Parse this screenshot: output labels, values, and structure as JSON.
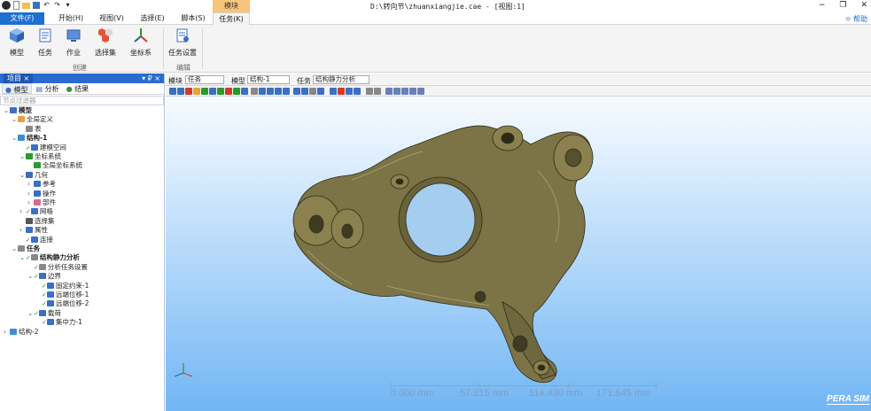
{
  "titlebar": {
    "title_path": "D:\\转向节\\zhuanxiangjie.cae - [视图:1]",
    "context_tab": "模块",
    "min_glyph": "−",
    "max_glyph": "❐",
    "close_glyph": "✕"
  },
  "tabs": [
    {
      "label": "文件(F)"
    },
    {
      "label": "开始(H)"
    },
    {
      "label": "视图(V)"
    },
    {
      "label": "选择(E)"
    },
    {
      "label": "脚本(S)"
    },
    {
      "label": "任务(K)"
    }
  ],
  "help_label": "≏ 帮助",
  "ribbon": {
    "buttons": [
      {
        "label": "模型",
        "icon": "model-cube-icon"
      },
      {
        "label": "任务",
        "icon": "task-icon"
      },
      {
        "label": "作业",
        "icon": "job-icon"
      },
      {
        "label": "选择集",
        "icon": "selection-set-icon"
      },
      {
        "label": "坐标系",
        "icon": "coordinate-system-icon"
      },
      {
        "label": "任务设置",
        "icon": "task-settings-icon"
      }
    ],
    "groups": [
      {
        "label": "创建"
      },
      {
        "label": "编辑"
      }
    ]
  },
  "left_panel": {
    "header_tab": "项目",
    "close_glyph": "×",
    "controls": "▾ ₽ ×",
    "subtabs": [
      {
        "label": "模型"
      },
      {
        "label": "分析"
      },
      {
        "label": "结果"
      }
    ],
    "filter_placeholder": "节点过滤器",
    "tree": [
      {
        "label": "模型",
        "arrow": "⌄",
        "check": "",
        "bold": true
      },
      {
        "label": "全局定义",
        "arrow": "⌄",
        "check": "",
        "bold": false
      },
      {
        "label": "表",
        "arrow": "",
        "check": "",
        "bold": false
      },
      {
        "label": "结构-1",
        "arrow": "⌄",
        "check": "",
        "bold": true
      },
      {
        "label": "建模空间",
        "arrow": "",
        "check": "✓",
        "bold": false
      },
      {
        "label": "坐标系统",
        "arrow": "⌄",
        "check": "",
        "bold": false
      },
      {
        "label": "全局坐标系统",
        "arrow": "",
        "check": "",
        "bold": false
      },
      {
        "label": "几何",
        "arrow": "⌄",
        "check": "",
        "bold": false
      },
      {
        "label": "参考",
        "arrow": "›",
        "check": "",
        "bold": false
      },
      {
        "label": "操作",
        "arrow": "›",
        "check": "",
        "bold": false
      },
      {
        "label": "部件",
        "arrow": "›",
        "check": "",
        "bold": false
      },
      {
        "label": "网格",
        "arrow": "›",
        "check": "✓",
        "bold": false
      },
      {
        "label": "选择集",
        "arrow": "",
        "check": "",
        "bold": false
      },
      {
        "label": "属性",
        "arrow": "›",
        "check": "",
        "bold": false
      },
      {
        "label": "连接",
        "arrow": "",
        "check": "✓",
        "bold": false
      },
      {
        "label": "任务",
        "arrow": "⌄",
        "check": "",
        "bold": true
      },
      {
        "label": "结构静力分析",
        "arrow": "⌄",
        "check": "✓",
        "bold": true
      },
      {
        "label": "分析任务设置",
        "arrow": "",
        "check": "✓",
        "bold": false
      },
      {
        "label": "边界",
        "arrow": "⌄",
        "check": "✓",
        "bold": false
      },
      {
        "label": "固定约束-1",
        "arrow": "",
        "check": "✓",
        "bold": false
      },
      {
        "label": "远端位移-1",
        "arrow": "",
        "check": "✓",
        "bold": false
      },
      {
        "label": "远端位移-2",
        "arrow": "",
        "check": "✓",
        "bold": false
      },
      {
        "label": "载荷",
        "arrow": "⌄",
        "check": "✓",
        "bold": false
      },
      {
        "label": "集中力-1",
        "arrow": "",
        "check": "✓",
        "bold": false
      },
      {
        "label": "结构-2",
        "arrow": "›",
        "check": "",
        "bold": false
      }
    ]
  },
  "viewport": {
    "module_label": "模块",
    "module_value": "任务",
    "model_label": "模型",
    "model_value": "结构-1",
    "task_label": "任务",
    "task_value": "结构静力分析",
    "scale_labels": [
      "0.000 mm",
      "57.215 mm",
      "114.430 mm",
      "171.645 mm"
    ],
    "logo": "PERA SIM"
  },
  "colors": {
    "accent": "#1e6fd0",
    "context_tab": "#f6c47a",
    "part": "#7c7446"
  }
}
